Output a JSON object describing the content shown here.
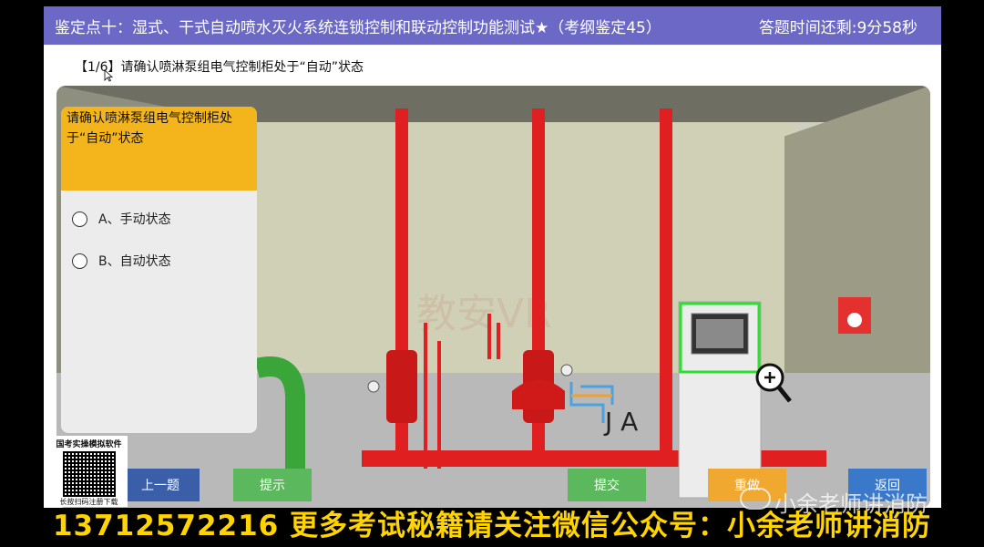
{
  "titlebar": {
    "title": "鉴定点十：湿式、干式自动喷水灭火系统连锁控制和联动控制功能测试★（考纲鉴定45）",
    "timer": "答题时间还剩:9分58秒"
  },
  "question": {
    "header": "【1/6】请确认喷淋泵组电气控制柜处于“自动”状态",
    "panel_text": "请确认喷淋泵组电气控制柜处于“自动”状态",
    "options": [
      {
        "label": "A、手动状态"
      },
      {
        "label": "B、自动状态"
      }
    ]
  },
  "scene": {
    "pump_label": "J A",
    "watermark": "教安VR"
  },
  "buttons": {
    "prev": "上一题",
    "hint": "提示",
    "submit": "提交",
    "redo": "重做",
    "back": "返回"
  },
  "qr": {
    "title": "国考实操模拟软件",
    "caption": "长按扫码注册下载"
  },
  "overlay": {
    "banner": "13712572216 更多考试秘籍请关注微信公众号：小余老师讲消防",
    "watermark": "小余老师讲消防"
  },
  "colors": {
    "titlebar": "#6b68c6",
    "question_panel": "#f3b41c",
    "prev_button": "#3a5fa8",
    "hint_button": "#5cb85c",
    "submit_button": "#5cb85c",
    "redo_button": "#f0a830",
    "back_button": "#3a79c9",
    "banner_text": "#ffd400",
    "pipe": "#e02020"
  }
}
